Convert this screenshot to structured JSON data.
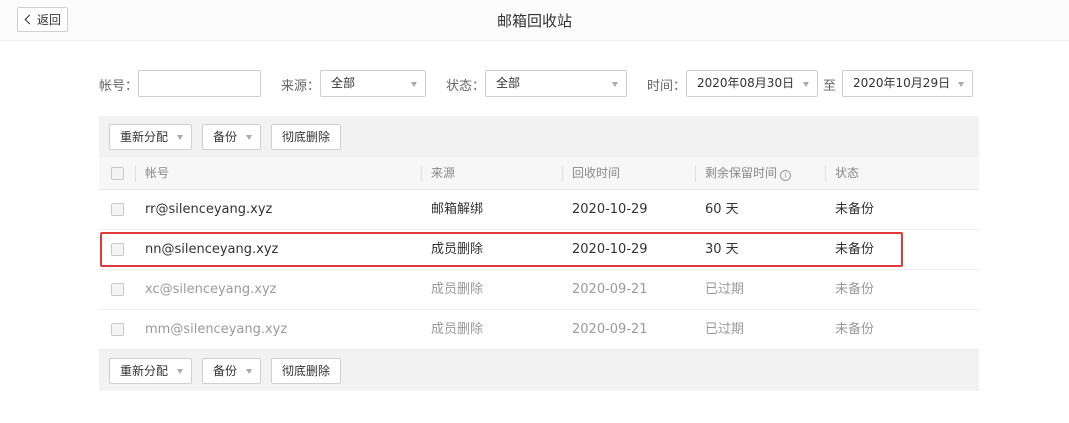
{
  "header": {
    "back_label": "返回",
    "title": "邮箱回收站"
  },
  "filters": {
    "account_label": "帐号：",
    "account_value": "",
    "source_label": "来源：",
    "source_value": "全部",
    "status_label": "状态：",
    "status_value": "全部",
    "time_label": "时间：",
    "date_from": "2020年08月30日",
    "to_label": "至",
    "date_to": "2020年10月29日"
  },
  "toolbar": {
    "reassign_label": "重新分配",
    "backup_label": "备份",
    "delete_label": "彻底删除"
  },
  "table": {
    "columns": {
      "account": "帐号",
      "source": "来源",
      "recycle_time": "回收时间",
      "remaining": "剩余保留时间",
      "status": "状态"
    },
    "rows": [
      {
        "account": "rr@silenceyang.xyz",
        "source": "邮箱解绑",
        "recycle_time": "2020-10-29",
        "remaining": "60 天",
        "status": "未备份"
      },
      {
        "account": "nn@silenceyang.xyz",
        "source": "成员删除",
        "recycle_time": "2020-10-29",
        "remaining": "30 天",
        "status": "未备份"
      },
      {
        "account": "xc@silenceyang.xyz",
        "source": "成员删除",
        "recycle_time": "2020-09-21",
        "remaining": "已过期",
        "status": "未备份"
      },
      {
        "account": "mm@silenceyang.xyz",
        "source": "成员删除",
        "recycle_time": "2020-09-21",
        "remaining": "已过期",
        "status": "未备份"
      }
    ]
  },
  "colors": {
    "highlight": "#e03a3a",
    "toolbar_bg": "#f2f2f2",
    "expired_text": "#9a9a9a"
  },
  "icons": [
    "chevron-left-icon",
    "caret-down-icon",
    "info-icon"
  ]
}
